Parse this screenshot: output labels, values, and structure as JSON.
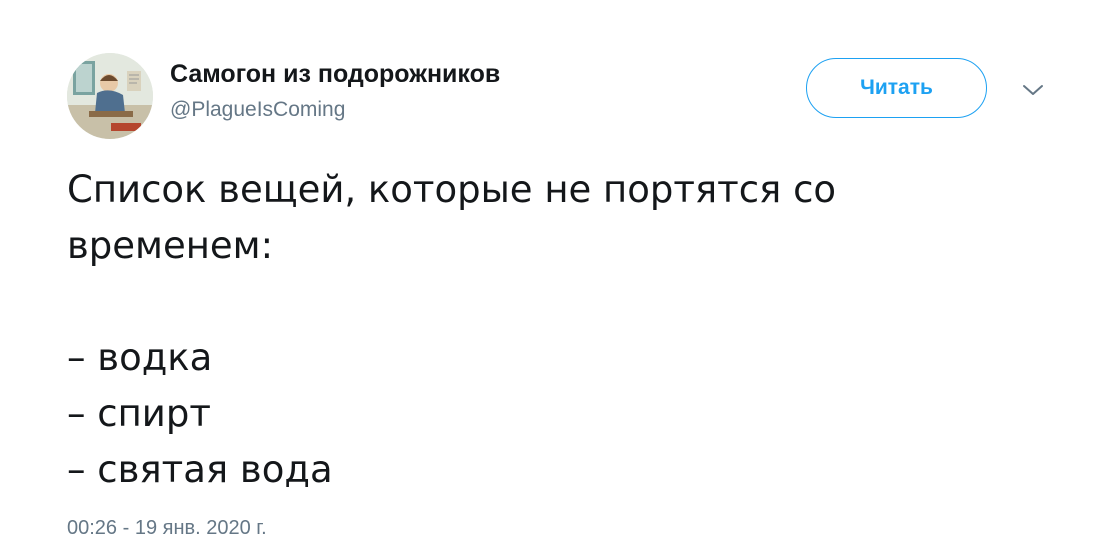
{
  "user": {
    "display_name": "Самогон из подорожников",
    "handle": "@PlagueIsComing",
    "avatar_icon": "avatar-illustration"
  },
  "actions": {
    "follow_label": "Читать",
    "menu_icon": "chevron-down-icon"
  },
  "tweet": {
    "text_lines": [
      "Список вещей, которые не портятся со",
      "временем:",
      "",
      "– водка",
      "– спирт",
      "– святая вода"
    ],
    "timestamp": "00:26 - 19 янв. 2020 г."
  },
  "colors": {
    "accent": "#1da1f2",
    "text_primary": "#14171a",
    "text_secondary": "#657786"
  }
}
